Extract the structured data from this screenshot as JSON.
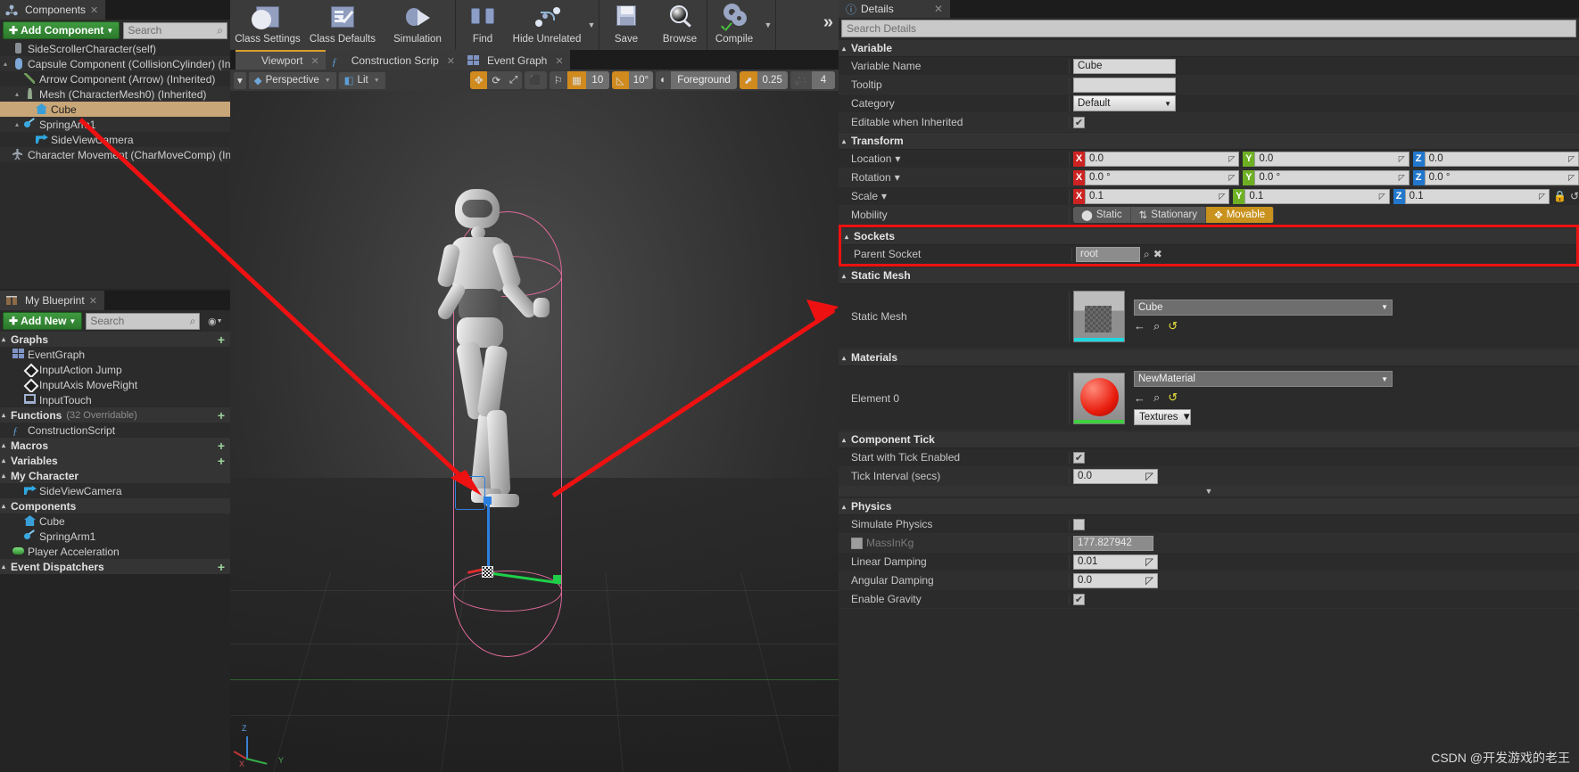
{
  "components_panel": {
    "tab_label": "Components",
    "tab_icon": "components-icon",
    "add_button": "Add Component",
    "search_placeholder": "Search",
    "tree": [
      {
        "label": "SideScrollerCharacter(self)",
        "icon": "self-icon",
        "indent": 0,
        "expander": "",
        "selected": false
      },
      {
        "label": "Capsule Component (CollisionCylinder) (Inheri",
        "icon": "capsule-icon",
        "indent": 0,
        "expander": "▴",
        "selected": false
      },
      {
        "label": "Arrow Component (Arrow) (Inherited)",
        "icon": "arrow-icon",
        "indent": 1,
        "expander": "",
        "selected": false
      },
      {
        "label": "Mesh (CharacterMesh0) (Inherited)",
        "icon": "mesh-icon",
        "indent": 1,
        "expander": "▴",
        "selected": false
      },
      {
        "label": "Cube",
        "icon": "static-mesh-icon",
        "indent": 2,
        "expander": "",
        "selected": true
      },
      {
        "label": "SpringArm1",
        "icon": "spring-arm-icon",
        "indent": 1,
        "expander": "▴",
        "selected": false
      },
      {
        "label": "SideViewCamera",
        "icon": "camera-icon",
        "indent": 2,
        "expander": "",
        "selected": false
      },
      {
        "label": "Character Movement (CharMoveComp) (Inheri",
        "icon": "char-movement-icon",
        "indent": 0,
        "expander": "",
        "selected": false
      }
    ]
  },
  "myblueprint_panel": {
    "tab_label": "My Blueprint",
    "add_button": "Add New",
    "search_placeholder": "Search",
    "sections": [
      {
        "type": "category",
        "label": "Graphs",
        "sub": "",
        "plus": "+"
      },
      {
        "type": "item",
        "label": "EventGraph",
        "icon": "graph-icon",
        "indent": 0
      },
      {
        "type": "item",
        "label": "InputAction Jump",
        "icon": "event-node-icon",
        "indent": 1
      },
      {
        "type": "item",
        "label": "InputAxis MoveRight",
        "icon": "event-node-icon",
        "indent": 1
      },
      {
        "type": "item",
        "label": "InputTouch",
        "icon": "touch-icon",
        "indent": 1
      },
      {
        "type": "category",
        "label": "Functions",
        "sub": "(32 Overridable)",
        "plus": "+"
      },
      {
        "type": "item",
        "label": "ConstructionScript",
        "icon": "function-icon",
        "indent": 0
      },
      {
        "type": "category",
        "label": "Macros",
        "sub": "",
        "plus": "+"
      },
      {
        "type": "category",
        "label": "Variables",
        "sub": "",
        "plus": "+"
      },
      {
        "type": "subcategory",
        "label": "My Character"
      },
      {
        "type": "item",
        "label": "SideViewCamera",
        "icon": "camera-icon",
        "indent": 1
      },
      {
        "type": "subcategory",
        "label": "Components"
      },
      {
        "type": "item",
        "label": "Cube",
        "icon": "static-mesh-icon",
        "indent": 1
      },
      {
        "type": "item",
        "label": "SpringArm1",
        "icon": "spring-arm-icon",
        "indent": 1
      },
      {
        "type": "item",
        "label": "Player Acceleration",
        "icon": "variable-icon",
        "indent": 0
      },
      {
        "type": "category",
        "label": "Event Dispatchers",
        "sub": "",
        "plus": "+"
      }
    ]
  },
  "toolbar": {
    "items": [
      {
        "label": "Compile",
        "icon": "compile-gear-icon",
        "has_caret": true
      },
      {
        "label": "Save",
        "icon": "save-floppy-icon",
        "has_caret": false
      },
      {
        "label": "Browse",
        "icon": "browse-magnifier-icon",
        "has_caret": false
      },
      {
        "label": "Find",
        "icon": "find-binoculars-icon",
        "has_caret": false
      },
      {
        "label": "Hide Unrelated",
        "icon": "hide-unrelated-nodes-icon",
        "has_caret": true
      },
      {
        "label": "Class Settings",
        "icon": "class-settings-icon",
        "has_caret": false
      },
      {
        "label": "Class Defaults",
        "icon": "class-defaults-icon",
        "has_caret": false
      },
      {
        "label": "Simulation",
        "icon": "simulation-icon",
        "has_caret": false
      }
    ],
    "overflow": "»"
  },
  "viewport": {
    "tabs": [
      {
        "label": "Viewport",
        "icon": "viewport-icon",
        "active": true
      },
      {
        "label": "Construction Scrip",
        "icon": "function-icon",
        "active": false
      },
      {
        "label": "Event Graph",
        "icon": "graph-icon",
        "active": false
      }
    ],
    "controls": {
      "view_menu": "▾",
      "perspective": "Perspective",
      "lit": "Lit",
      "translate_icon": "translate-gizmo-icon",
      "rotate_icon": "rotate-gizmo-icon",
      "scale_icon": "scale-gizmo-icon",
      "coordinate_icon": "world-space-icon",
      "surface_snap_icon": "surface-snap-icon",
      "grid_snap_icon": "grid-snap-icon",
      "grid_snap_value": "10",
      "angle_snap_icon": "angle-snap-icon",
      "angle_snap_value": "10°",
      "scale_snap_icon": "scale-snap-icon",
      "scale_snap_value": "Foreground",
      "camera_speed_icon": "camera-speed-icon",
      "camera_speed_value": "0.25",
      "fov_icon": "field-of-view-icon",
      "fov_value": "4"
    },
    "axis_labels": {
      "x": "X",
      "y": "Y",
      "z": "Z"
    },
    "watermark": "CSDN @开发游戏的老王"
  },
  "details_panel": {
    "tab_label": "Details",
    "tab_icon": "details-info-icon",
    "search_placeholder": "Search Details",
    "sections": [
      {
        "name": "Variable",
        "highlight": false,
        "rows": [
          {
            "label": "Variable Name",
            "type": "text",
            "value": "Cube"
          },
          {
            "label": "Tooltip",
            "type": "text",
            "value": ""
          },
          {
            "label": "Category",
            "type": "combo",
            "value": "Default"
          },
          {
            "label": "Editable when Inherited",
            "type": "checkbox",
            "value": true
          }
        ]
      },
      {
        "name": "Transform",
        "highlight": false,
        "rows": [
          {
            "label": "Location",
            "type": "vector",
            "dropdown": true,
            "x": "0.0",
            "y": "0.0",
            "z": "0.0"
          },
          {
            "label": "Rotation",
            "type": "vector",
            "dropdown": true,
            "x": "0.0 °",
            "y": "0.0 °",
            "z": "0.0 °"
          },
          {
            "label": "Scale",
            "type": "vector",
            "dropdown": true,
            "x": "0.1",
            "y": "0.1",
            "z": "0.1",
            "lock": true
          },
          {
            "label": "Mobility",
            "type": "mobility",
            "options": [
              "Static",
              "Stationary",
              "Movable"
            ],
            "selected": "Movable"
          }
        ]
      },
      {
        "name": "Sockets",
        "highlight": true,
        "rows": [
          {
            "label": "Parent Socket",
            "type": "socket",
            "value": "root",
            "buttons": [
              "search-icon",
              "clear-icon"
            ]
          }
        ]
      },
      {
        "name": "Static Mesh",
        "highlight": false,
        "rows": [
          {
            "label": "Static Mesh",
            "type": "asset",
            "value": "Cube",
            "thumbnail": "cube-thumbnail",
            "buttons": [
              "use-selected-icon",
              "browse-icon",
              "reset-icon"
            ]
          }
        ]
      },
      {
        "name": "Materials",
        "highlight": false,
        "rows": [
          {
            "label": "Element 0",
            "type": "material",
            "value": "NewMaterial",
            "thumbnail": "material-sphere-thumbnail",
            "buttons": [
              "use-selected-icon",
              "browse-icon",
              "reset-icon"
            ],
            "extra_button": "Textures"
          }
        ]
      },
      {
        "name": "Component Tick",
        "highlight": false,
        "rows": [
          {
            "label": "Start with Tick Enabled",
            "type": "checkbox",
            "value": true
          },
          {
            "label": "Tick Interval (secs)",
            "type": "number",
            "value": "0.0"
          }
        ]
      },
      {
        "name": "Physics",
        "highlight": false,
        "rows": [
          {
            "label": "Simulate Physics",
            "type": "checkbox",
            "value": false
          },
          {
            "label": "MassInKg",
            "type": "checkbox_number",
            "checked": false,
            "value": "177.827942"
          },
          {
            "label": "Linear Damping",
            "type": "number",
            "value": "0.01"
          },
          {
            "label": "Angular Damping",
            "type": "number",
            "value": "0.0"
          },
          {
            "label": "Enable Gravity",
            "type": "checkbox",
            "value": true
          }
        ]
      }
    ]
  },
  "annotations": {
    "highlight_color": "#ee1111",
    "arrows": 2
  },
  "icons": {
    "search": "⌕",
    "clear": "✖",
    "back_arrow": "←",
    "reset": "↺",
    "caret_down": "▾",
    "collapse": "▴"
  }
}
